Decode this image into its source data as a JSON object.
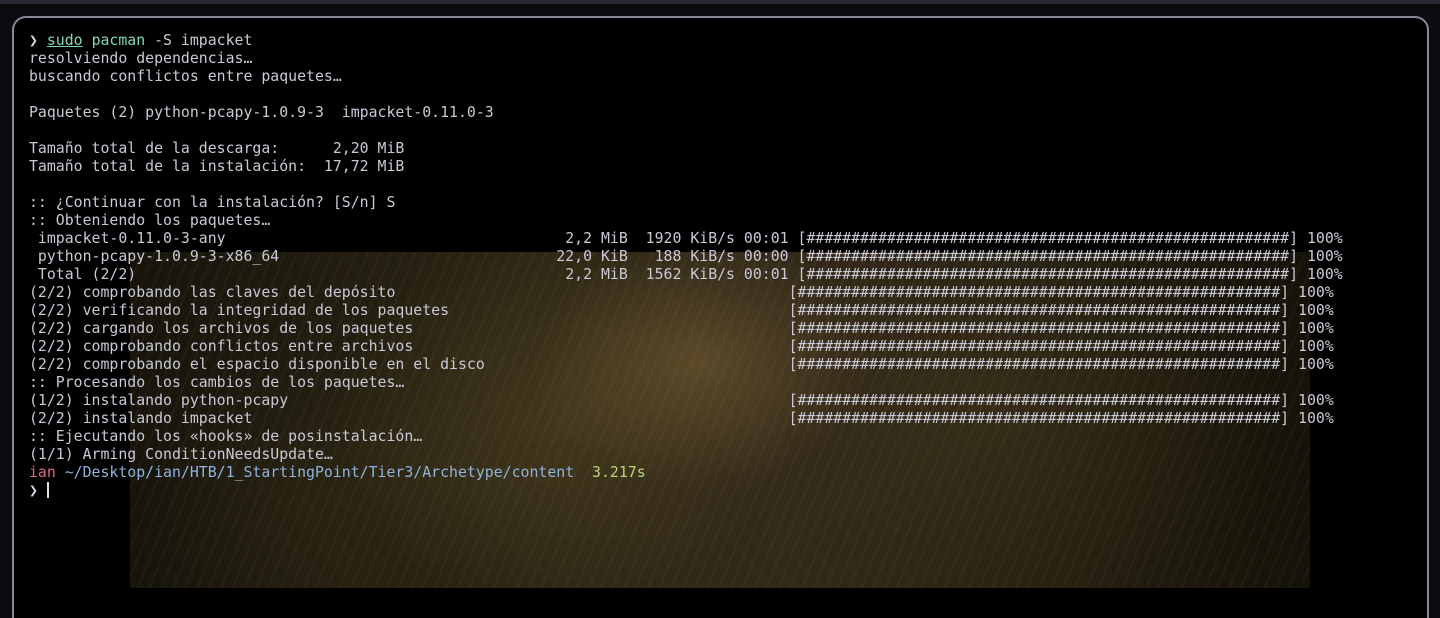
{
  "terminal": {
    "prompt_symbol": "❯",
    "command": {
      "sudo": "sudo",
      "program": "pacman",
      "args": " -S impacket"
    },
    "output_lines": [
      "resolviendo dependencias…",
      "buscando conflictos entre paquetes…",
      "",
      "Paquetes (2) python-pcapy-1.0.9-3  impacket-0.11.0-3",
      "",
      "Tamaño total de la descarga:      2,20 MiB",
      "Tamaño total de la instalación:  17,72 MiB",
      "",
      ":: ¿Continuar con la instalación? [S/n] S",
      ":: Obteniendo los paquetes…",
      " impacket-0.11.0-3-any                                      2,2 MiB  1920 KiB/s 00:01 [######################################################] 100%",
      " python-pcapy-1.0.9-3-x86_64                               22,0 KiB   188 KiB/s 00:00 [######################################################] 100%",
      " Total (2/2)                                                2,2 MiB  1562 KiB/s 00:01 [######################################################] 100%",
      "(2/2) comprobando las claves del depósito                                            [######################################################] 100%",
      "(2/2) verificando la integridad de los paquetes                                      [######################################################] 100%",
      "(2/2) cargando los archivos de los paquetes                                          [######################################################] 100%",
      "(2/2) comprobando conflictos entre archivos                                          [######################################################] 100%",
      "(2/2) comprobando el espacio disponible en el disco                                  [######################################################] 100%",
      ":: Procesando los cambios de los paquetes…",
      "(1/2) instalando python-pcapy                                                        [######################################################] 100%",
      "(2/2) instalando impacket                                                            [######################################################] 100%",
      ":: Ejecutando los «hooks» de posinstalación…",
      "(1/1) Arming ConditionNeedsUpdate…"
    ],
    "status": {
      "user": "ian",
      "path": " ~/Desktop/ian/HTB/1_StartingPoint/Tier3/Archetype/content",
      "elapsed": "  3.217s"
    }
  },
  "colors": {
    "text": "#c9c9d6",
    "command": "#7fd7c0",
    "user": "#d96b7c",
    "path": "#8fb2e0",
    "elapsed": "#b9d878",
    "window_border": "#8a8794"
  }
}
